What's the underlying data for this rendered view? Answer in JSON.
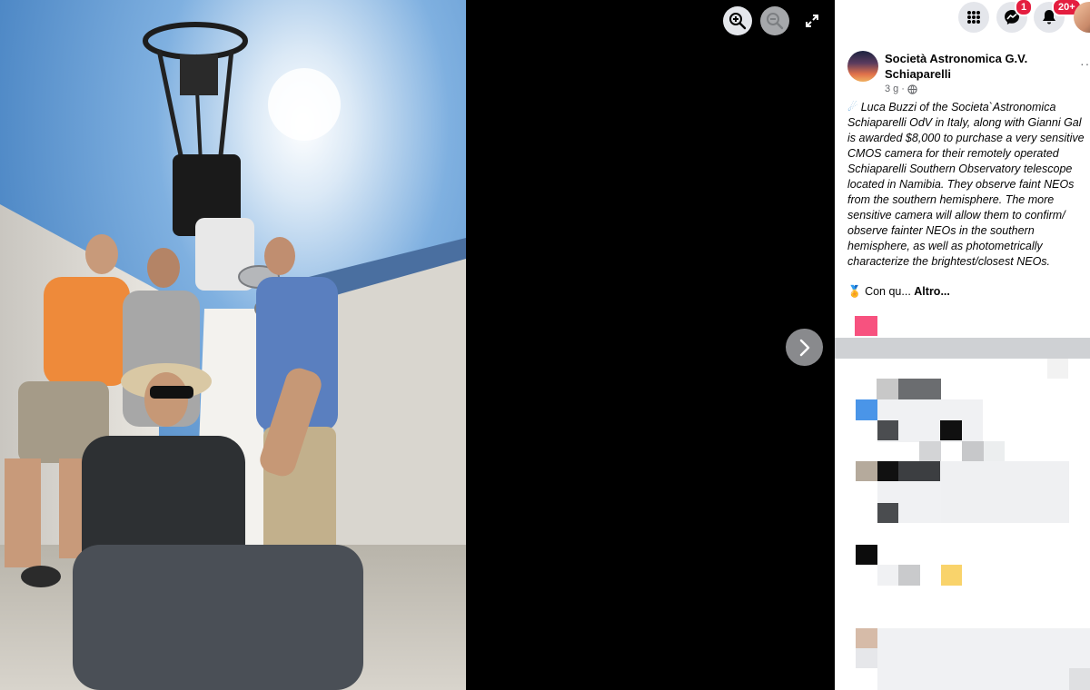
{
  "viewer": {
    "photo_alt_icon": "group-photo-telescope",
    "zoom_in_icon": "zoom-in-icon",
    "zoom_out_icon": "zoom-out-icon",
    "fullscreen_icon": "fullscreen-icon",
    "next_icon": "chevron-right-icon"
  },
  "header": {
    "messenger_badge": "1",
    "notifications_badge": "20+"
  },
  "post": {
    "page_name": "Società Astronomica G.V. Schiaparelli",
    "time": "3 g",
    "separator": "·",
    "text": "Luca Buzzi of the Societa`Astronomica Schiaparelli OdV in Italy, along with Gianni Gal is awarded $8,000 to purchase a very sensitive CMOS camera for their remotely operated Schiaparelli Southern Observatory telescope located in Namibia. They observe faint NEOs from the southern hemisphere. The more sensitive camera will allow them to confirm/ observe fainter NEOs in the southern hemisphere, as well as photometrically characterize the brightest/closest NEOs.",
    "more_prefix": "Con qu...",
    "more_link": "Altro...",
    "more_options": "···"
  },
  "colors": {
    "accent": "#1877f2",
    "badge": "#e41e3f",
    "icon_bg": "#e4e6eb"
  }
}
